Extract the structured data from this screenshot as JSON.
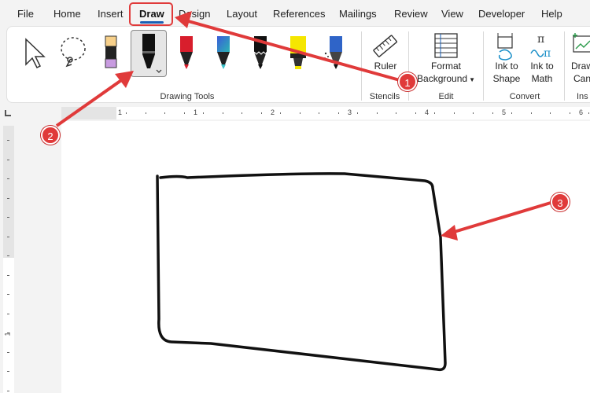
{
  "menu": {
    "tabs": [
      {
        "label": "File"
      },
      {
        "label": "Home"
      },
      {
        "label": "Insert"
      },
      {
        "label": "Draw"
      },
      {
        "label": "Design"
      },
      {
        "label": "Layout"
      },
      {
        "label": "References"
      },
      {
        "label": "Mailings"
      },
      {
        "label": "Review"
      },
      {
        "label": "View"
      },
      {
        "label": "Developer"
      },
      {
        "label": "Help"
      }
    ],
    "active_tab": "Draw"
  },
  "ribbon": {
    "groups": {
      "drawing_tools": "Drawing Tools",
      "stencils": "Stencils",
      "edit": "Edit",
      "convert": "Convert",
      "insert": "Ins"
    },
    "buttons": {
      "ruler": "Ruler",
      "format_background_1": "Format",
      "format_background_2": "Background",
      "ink_to_shape_1": "Ink to",
      "ink_to_shape_2": "Shape",
      "ink_to_math_1": "Ink to",
      "ink_to_math_2": "Math",
      "draw_canvas_1": "Draw",
      "draw_canvas_2": "Can"
    },
    "tools": [
      {
        "icon": "select-arrow-icon"
      },
      {
        "icon": "lasso-select-icon"
      },
      {
        "icon": "eraser-icon"
      },
      {
        "icon": "black-pen-icon",
        "selected": true
      },
      {
        "icon": "red-pen-icon"
      },
      {
        "icon": "galaxy-pen-icon"
      },
      {
        "icon": "glitter-pen-icon"
      },
      {
        "icon": "yellow-highlighter-icon"
      },
      {
        "icon": "blue-pencil-icon"
      }
    ]
  },
  "ruler": {
    "numbers": [
      "1",
      "1",
      "2",
      "3",
      "4",
      "5",
      "6"
    ],
    "v_numbers": [
      "1"
    ]
  },
  "callouts": [
    "1",
    "2",
    "3"
  ],
  "colors": {
    "accent": "#1a5fb4",
    "callout_red": "#e03a3a",
    "ink": "#111111"
  }
}
